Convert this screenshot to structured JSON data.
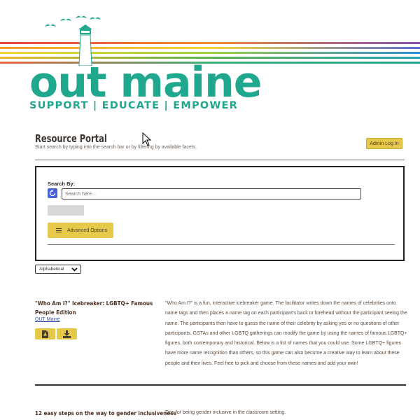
{
  "brand": {
    "name": "out maine",
    "tagline": "SUPPORT | EDUCATE | EMPOWER",
    "primary_color": "#1fa88e",
    "stripe_colors": [
      "#e8453c",
      "#f39a2b",
      "#f4d33a",
      "#5bb64c",
      "#2f8ad1",
      "#8a4fb3"
    ]
  },
  "portal": {
    "title": "Resource Portal",
    "subtitle": "Start search by typing into the search bar or by filtering by available facets.",
    "admin_button": "Admin Log In"
  },
  "search": {
    "label": "Search By:",
    "placeholder": "Search here...",
    "advanced_button": "Advanced Options",
    "sort_selected": "Alphabetical"
  },
  "results": [
    {
      "title": "\"Who Am I?\" Icebreaker: LGBTQ+ Famous People Edition",
      "author": "OUT Maine",
      "description": "\"Who Am I?\" is a fun, interactive icebreaker game. The facilitator writes down the names of celebrities onto name tags and then places a name tag on each participant's back or forehead without the participant seeing the name. The participants then have to guess the name of their celebrity by asking yes or no questions of other participants. GSTAs and other LGBTQ gatherings can modify the game by using the names of famous LGBTQ+ figures, both contemporary and historical. Below is a list of names that you could use. Some LGBTQ+ figures have more name recognition than others, so this game can also become a creative way to learn about these people and their lives. Feel free to pick and choose from these names and add your own!",
      "icons": [
        "pdf-icon",
        "download-icon"
      ]
    },
    {
      "title": "12 easy steps on the way to gender inclusiveness",
      "description": "Tips for being gender inclusive in the classroom setting."
    }
  ]
}
